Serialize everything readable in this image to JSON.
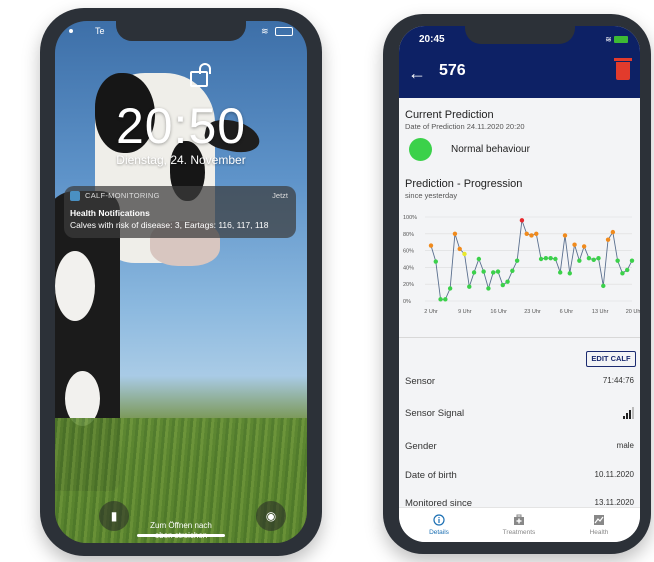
{
  "lockscreen": {
    "carrier": "Te",
    "time": "20:50",
    "date": "Dienstag, 24. November",
    "notification": {
      "app": "CALF-MONITORING",
      "when": "Jetzt",
      "title": "Health Notifications",
      "body": "Calves with risk of disease: 3, Eartags: 116, 117, 118"
    },
    "unlock_hint_line1": "Zum Öffnen nach",
    "unlock_hint_line2": "oben streichen",
    "flashlight_icon": "flashlight-icon",
    "camera_icon": "camera-icon"
  },
  "app": {
    "status_time": "20:45",
    "header_title": "576",
    "current_prediction": {
      "heading": "Current Prediction",
      "date": "Date of Prediction 24.11.2020  20:20",
      "status_label": "Normal behaviour",
      "status_color": "#3bd14a"
    },
    "progression": {
      "heading": "Prediction - Progression",
      "subheading": "since yesterday"
    },
    "edit_label": "EDIT CALF",
    "details": [
      {
        "label": "Sensor",
        "value": "71:44:76"
      },
      {
        "label": "Sensor Signal",
        "value": ""
      },
      {
        "label": "Gender",
        "value": "male"
      },
      {
        "label": "Date of birth",
        "value": "10.11.2020"
      },
      {
        "label": "Monitored since",
        "value": "13.11.2020"
      }
    ],
    "signal_level": 0.75,
    "tabs": [
      {
        "label": "Details",
        "icon": "info-icon"
      },
      {
        "label": "Treatments",
        "icon": "medical-kit-icon"
      },
      {
        "label": "Health",
        "icon": "chart-icon"
      }
    ],
    "colors": {
      "header": "#0d2165",
      "accent": "#1b6fb3",
      "delete": "#e23b2c"
    }
  },
  "chart_data": {
    "type": "line",
    "x_ticks": [
      "2 Uhr",
      "9 Uhr",
      "16 Uhr",
      "23 Uhr",
      "6 Uhr",
      "13 Uhr",
      "20 Uhr"
    ],
    "y_ticks": [
      "0%",
      "20%",
      "40%",
      "60%",
      "80%",
      "100%"
    ],
    "ylim": [
      0,
      100
    ],
    "grid": true,
    "values": [
      66,
      47,
      2,
      2,
      15,
      80,
      62,
      56,
      17,
      34,
      50,
      35,
      15,
      34,
      35,
      19,
      23,
      36,
      48,
      96,
      80,
      78,
      80,
      50,
      51,
      51,
      50,
      34,
      78,
      33,
      67,
      48,
      65,
      51,
      49,
      51,
      18,
      73,
      82,
      48,
      33,
      37,
      48
    ],
    "point_colors": {
      "low": "#3bd14a",
      "medium": "#e8e82a",
      "high": "#f08a1c",
      "critical": "#e8272c"
    }
  }
}
